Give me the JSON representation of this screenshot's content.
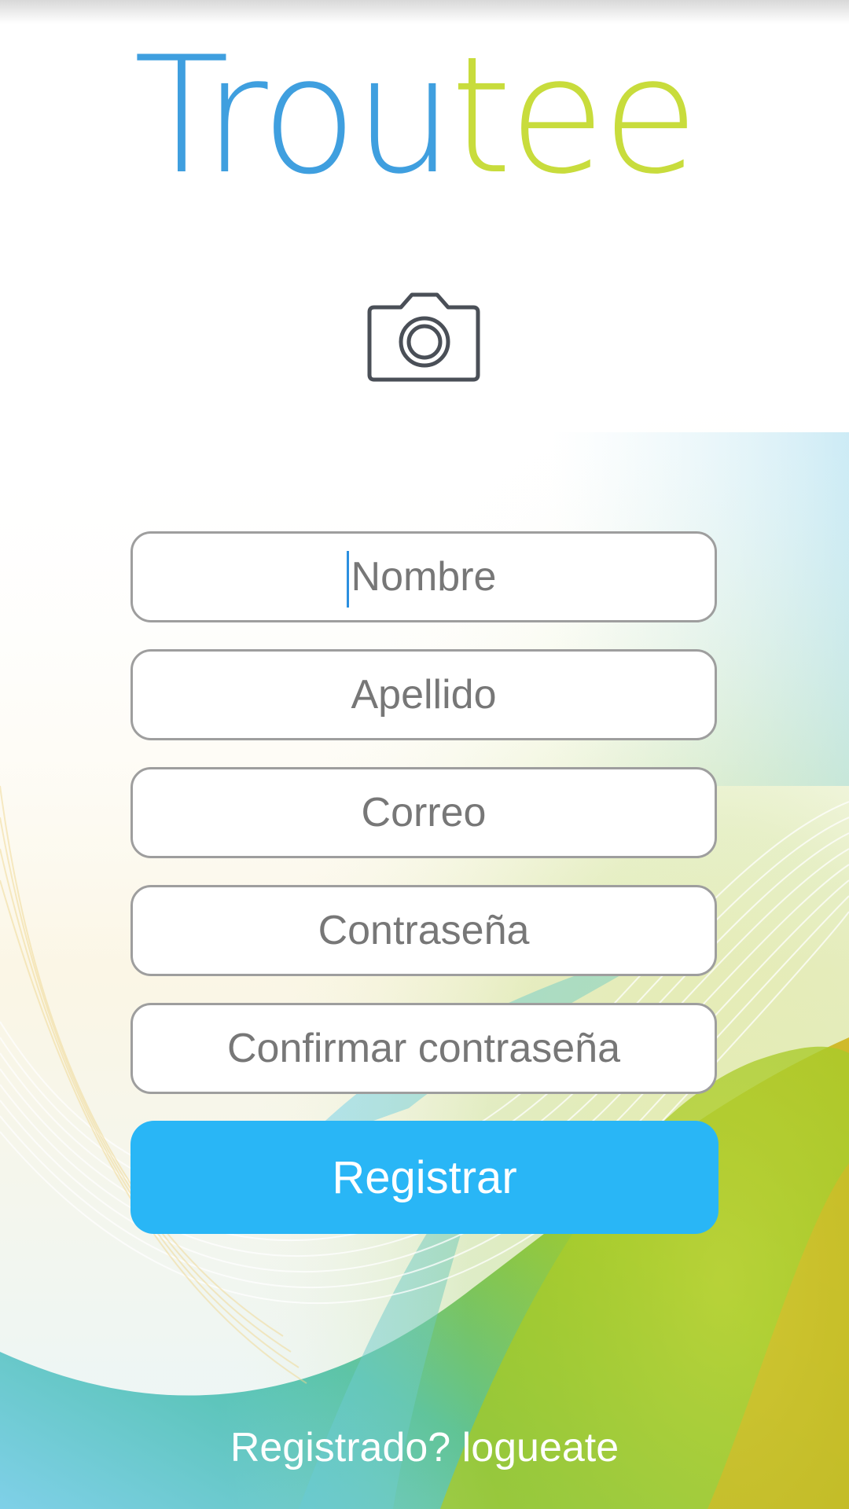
{
  "app": {
    "logo_part1": "Trou",
    "logo_part2": "tee",
    "logo_color_blue": "#3f9fdf",
    "logo_color_green": "#c8dc3c"
  },
  "photo": {
    "icon": "camera-icon"
  },
  "form": {
    "fields": [
      {
        "placeholder": "Nombre",
        "value": ""
      },
      {
        "placeholder": "Apellido",
        "value": ""
      },
      {
        "placeholder": "Correo",
        "value": ""
      },
      {
        "placeholder": "Contraseña",
        "value": ""
      },
      {
        "placeholder": "Confirmar contraseña",
        "value": ""
      }
    ],
    "submit_label": "Registrar",
    "submit_color": "#29b6f6"
  },
  "footer": {
    "login_link": "Registrado? logueate"
  }
}
